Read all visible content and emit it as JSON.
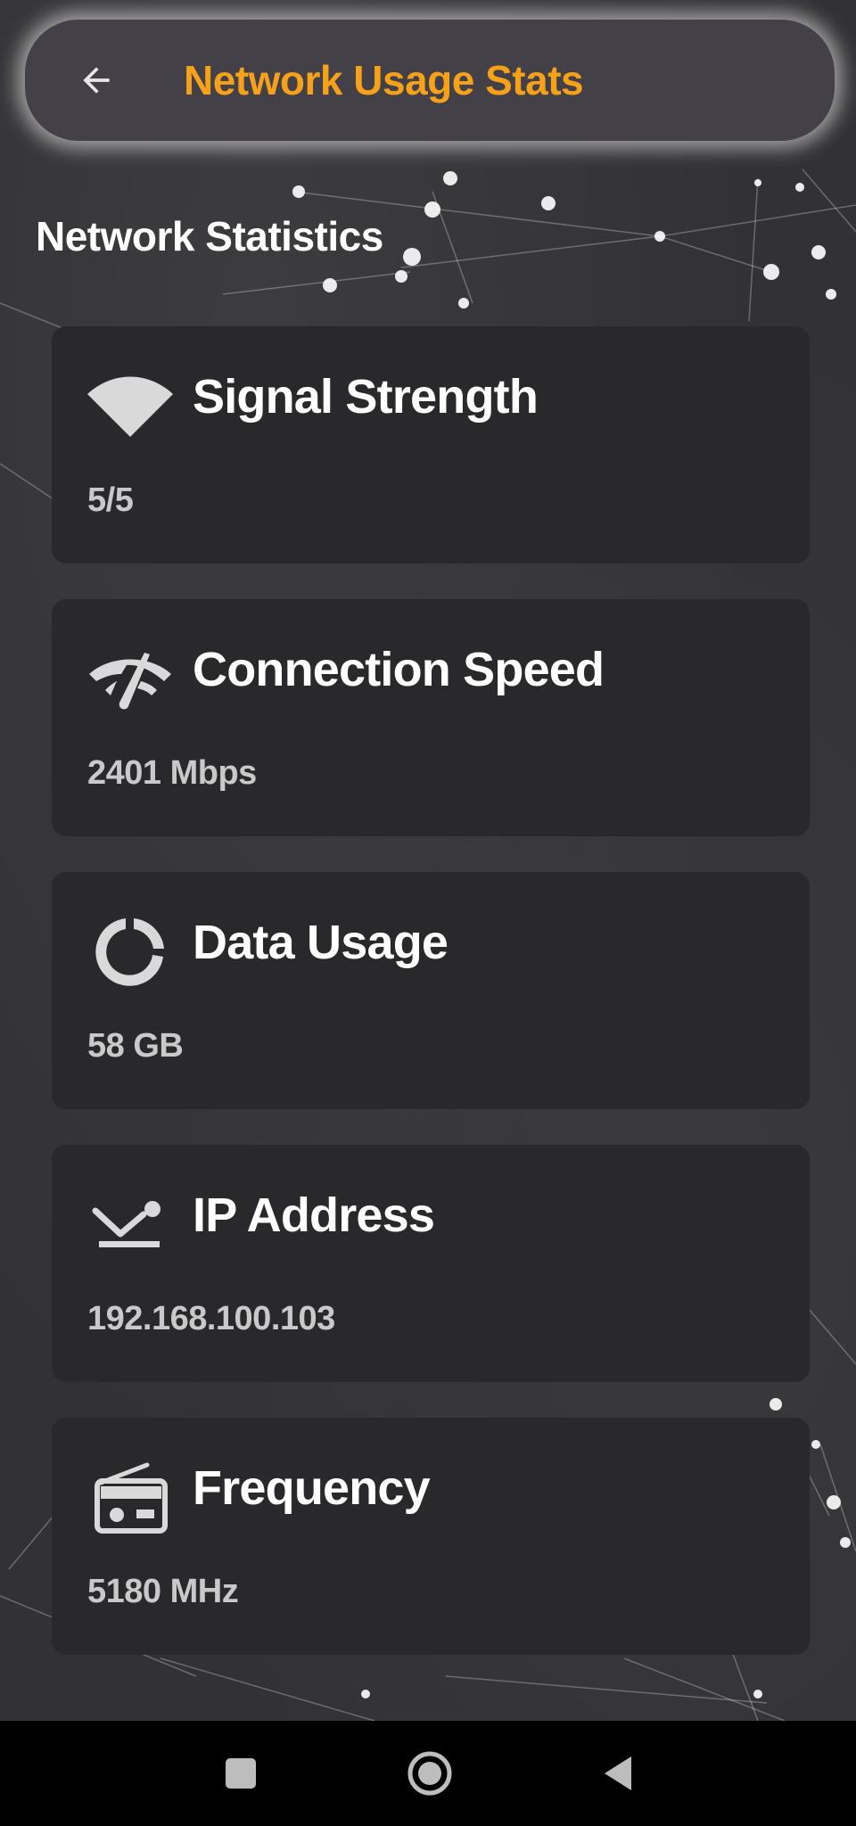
{
  "app": {
    "title": "Network Usage Stats"
  },
  "section": {
    "heading": "Network Statistics"
  },
  "stats": [
    {
      "label": "Signal Strength",
      "value": "5/5",
      "icon": "wifi-icon"
    },
    {
      "label": "Connection Speed",
      "value": "2401 Mbps",
      "icon": "network-check-icon"
    },
    {
      "label": "Data Usage",
      "value": "58 GB",
      "icon": "data-usage-icon"
    },
    {
      "label": "IP Address",
      "value": "192.168.100.103",
      "icon": "settings-ethernet-icon"
    },
    {
      "label": "Frequency",
      "value": "5180 MHz",
      "icon": "radio-icon"
    }
  ],
  "colors": {
    "accent": "#f5a11a",
    "card": "#29292b",
    "topbar": "#434047",
    "text": "#ffffff",
    "value_text": "#c9c9c9",
    "icon": "#d9d9d9"
  },
  "system_nav": {
    "icons": [
      "recents-square-icon",
      "home-circle-icon",
      "back-triangle-icon"
    ]
  }
}
